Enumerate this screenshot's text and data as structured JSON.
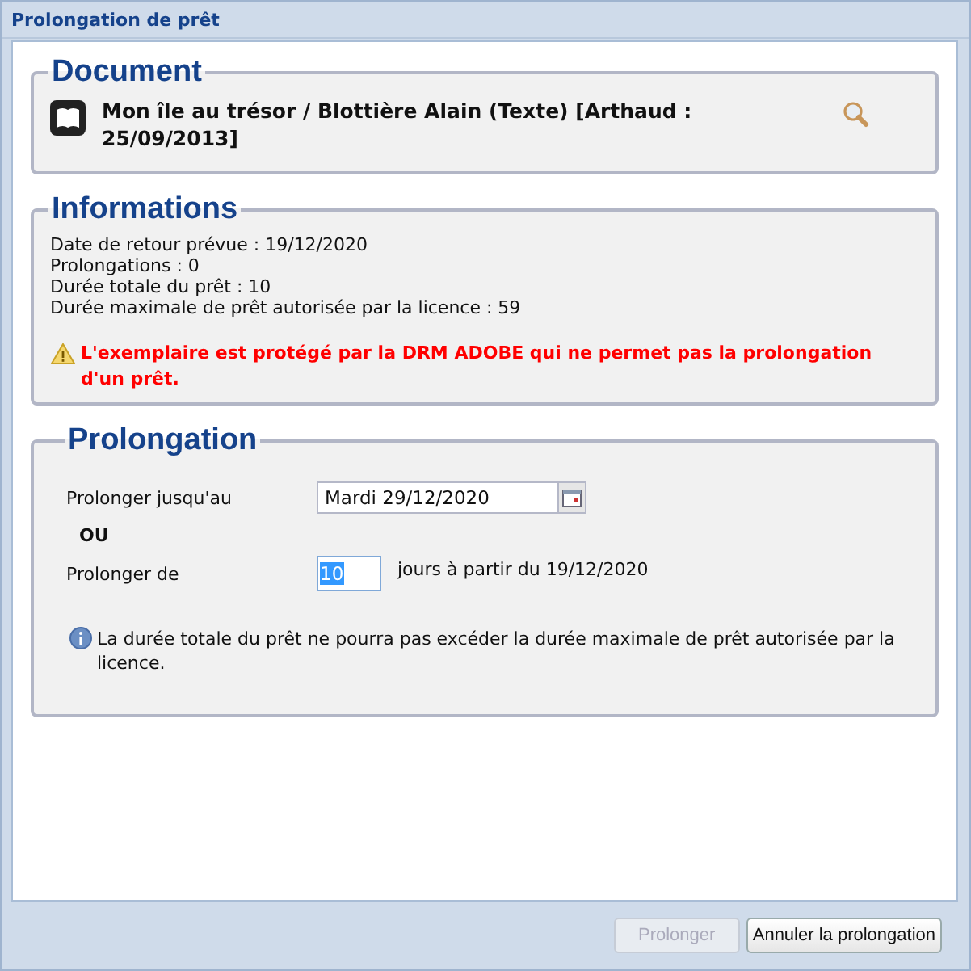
{
  "window": {
    "title": "Prolongation de prêt"
  },
  "document": {
    "legend": "Document",
    "title": "Mon île au trésor / Blottière Alain (Texte) [Arthaud : 25/09/2013]"
  },
  "informations": {
    "legend": "Informations",
    "lines": [
      "Date de retour prévue : 19/12/2020",
      "Prolongations : 0",
      "Durée totale du prêt : 10",
      "Durée maximale de prêt autorisée par la licence : 59"
    ],
    "warning": "L'exemplaire est protégé par la DRM ADOBE qui ne permet pas la prolongation d'un prêt."
  },
  "prolongation": {
    "legend": "Prolongation",
    "until_label": "Prolonger jusqu'au",
    "until_value": "Mardi 29/12/2020",
    "or_label": "OU",
    "by_label": "Prolonger de",
    "by_value": "10",
    "by_suffix": "jours à partir du 19/12/2020",
    "info": "La durée totale du prêt ne pourra pas excéder la durée maximale de prêt autorisée par la licence."
  },
  "buttons": [
    {
      "label": "Prolonger",
      "disabled": true
    },
    {
      "label": "Annuler la prolongation",
      "disabled": false
    }
  ]
}
